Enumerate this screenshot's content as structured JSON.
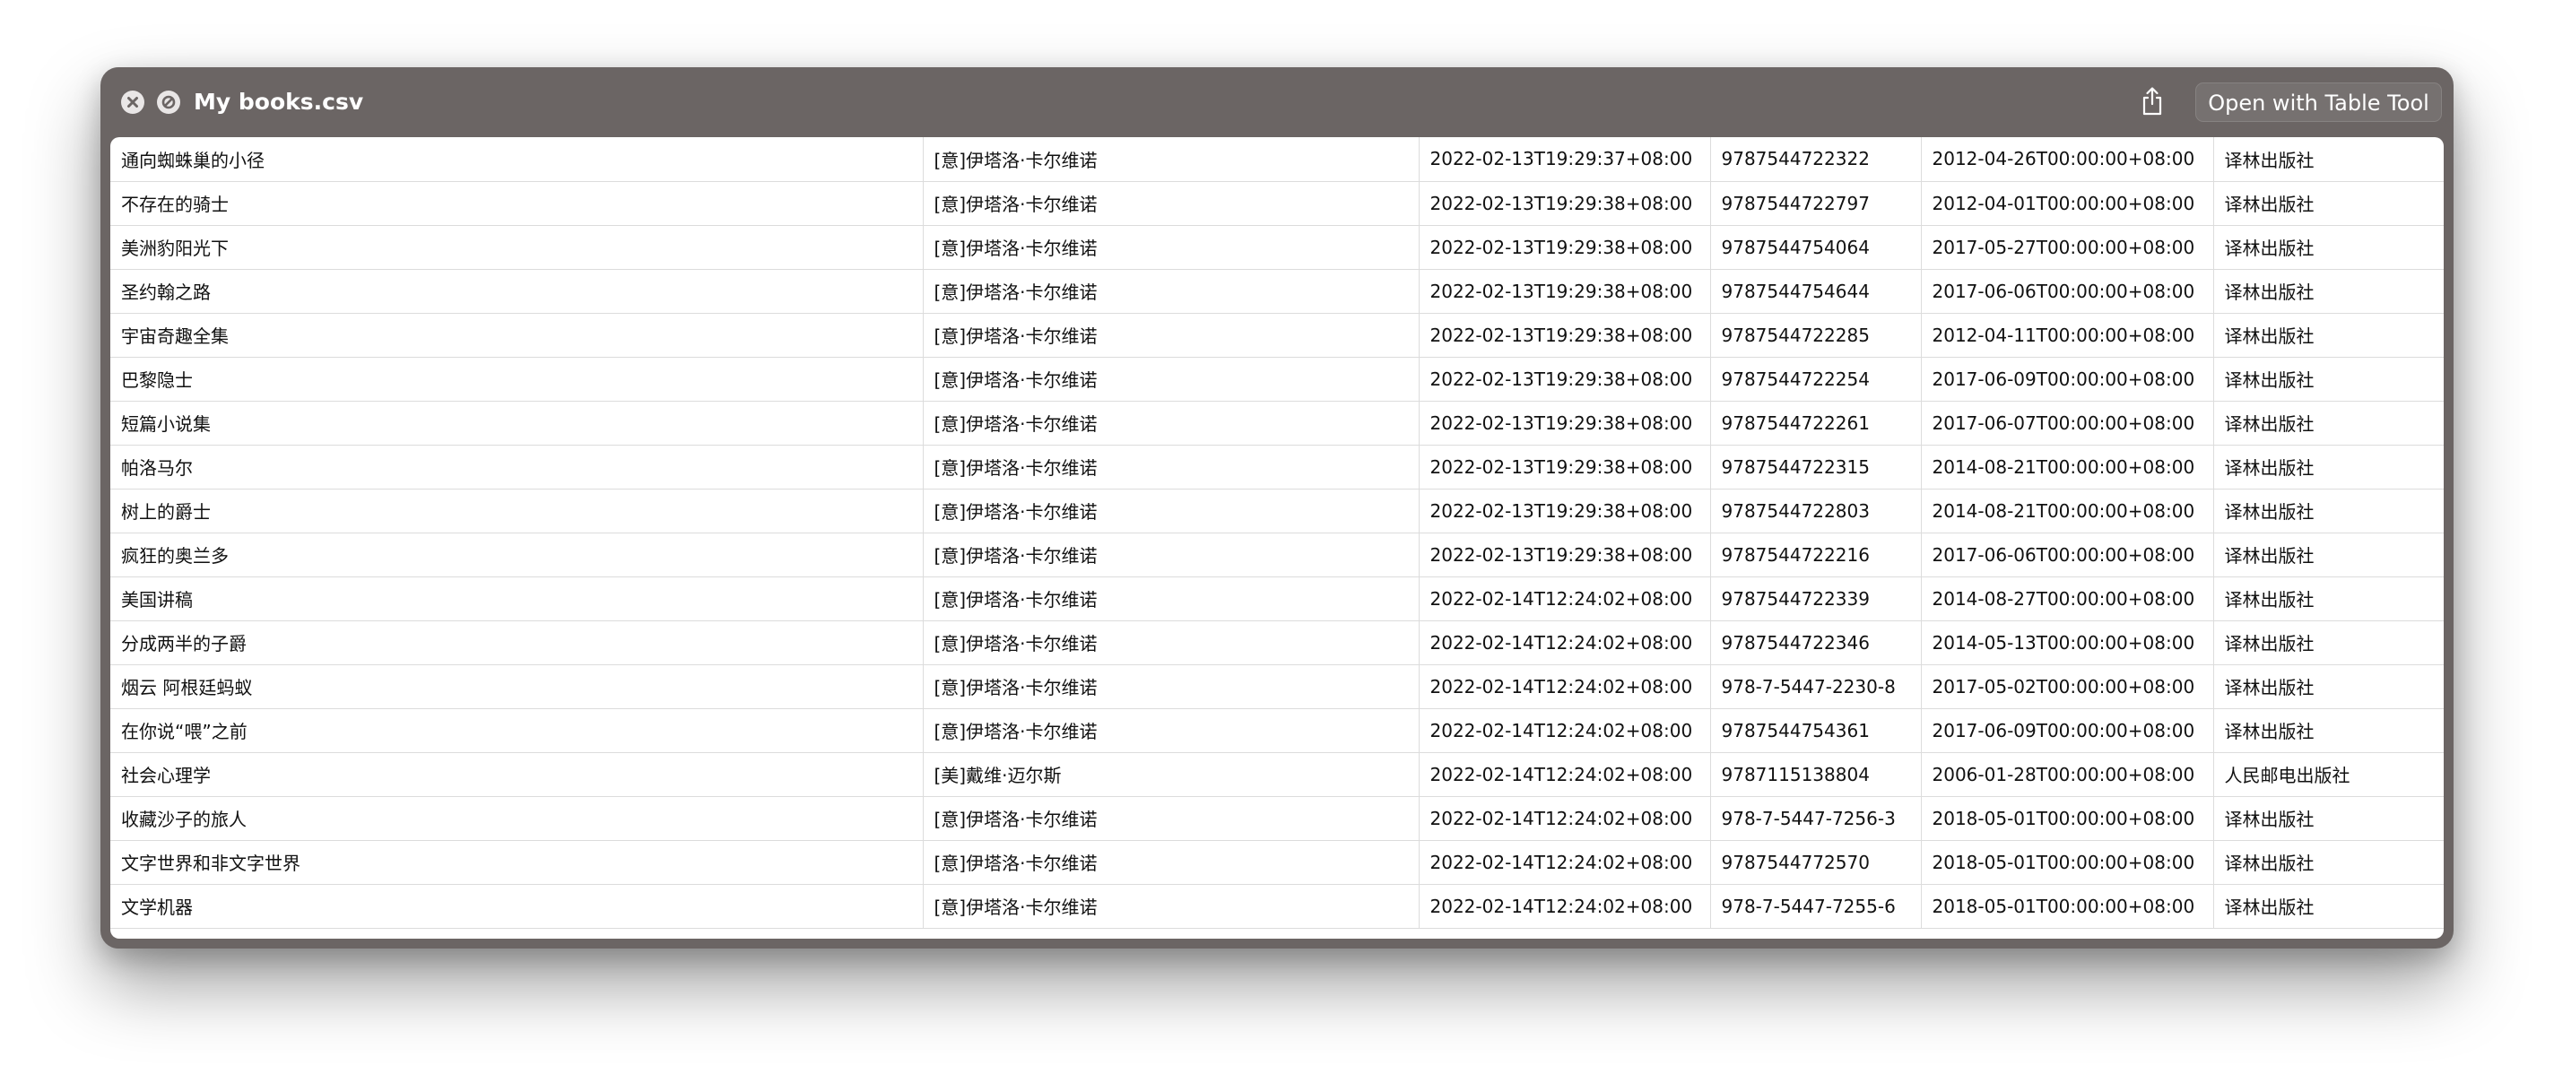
{
  "window": {
    "title": "My books.csv",
    "open_button_label": "Open with Table Tool"
  },
  "icons": {
    "close": "close-icon",
    "quicklook": "quicklook-icon",
    "share": "share-icon"
  },
  "colors": {
    "titlebar": "#6b6564",
    "grid": "#dcdcdc"
  },
  "table": {
    "rows": [
      [
        "通向蜘蛛巢的小径",
        "[意]伊塔洛·卡尔维诺",
        "2022-02-13T19:29:37+08:00",
        "9787544722322",
        "2012-04-26T00:00:00+08:00",
        "译林出版社"
      ],
      [
        "不存在的骑士",
        "[意]伊塔洛·卡尔维诺",
        "2022-02-13T19:29:38+08:00",
        "9787544722797",
        "2012-04-01T00:00:00+08:00",
        "译林出版社"
      ],
      [
        "美洲豹阳光下",
        "[意]伊塔洛·卡尔维诺",
        "2022-02-13T19:29:38+08:00",
        "9787544754064",
        "2017-05-27T00:00:00+08:00",
        "译林出版社"
      ],
      [
        "圣约翰之路",
        "[意]伊塔洛·卡尔维诺",
        "2022-02-13T19:29:38+08:00",
        "9787544754644",
        "2017-06-06T00:00:00+08:00",
        "译林出版社"
      ],
      [
        "宇宙奇趣全集",
        "[意]伊塔洛·卡尔维诺",
        "2022-02-13T19:29:38+08:00",
        "9787544722285",
        "2012-04-11T00:00:00+08:00",
        "译林出版社"
      ],
      [
        "巴黎隐士",
        "[意]伊塔洛·卡尔维诺",
        "2022-02-13T19:29:38+08:00",
        "9787544722254",
        "2017-06-09T00:00:00+08:00",
        "译林出版社"
      ],
      [
        "短篇小说集",
        "[意]伊塔洛·卡尔维诺",
        "2022-02-13T19:29:38+08:00",
        "9787544722261",
        "2017-06-07T00:00:00+08:00",
        "译林出版社"
      ],
      [
        "帕洛马尔",
        "[意]伊塔洛·卡尔维诺",
        "2022-02-13T19:29:38+08:00",
        "9787544722315",
        "2014-08-21T00:00:00+08:00",
        "译林出版社"
      ],
      [
        "树上的爵士",
        "[意]伊塔洛·卡尔维诺",
        "2022-02-13T19:29:38+08:00",
        "9787544722803",
        "2014-08-21T00:00:00+08:00",
        "译林出版社"
      ],
      [
        "疯狂的奥兰多",
        "[意]伊塔洛·卡尔维诺",
        "2022-02-13T19:29:38+08:00",
        "9787544722216",
        "2017-06-06T00:00:00+08:00",
        "译林出版社"
      ],
      [
        "美国讲稿",
        "[意]伊塔洛·卡尔维诺",
        "2022-02-14T12:24:02+08:00",
        "9787544722339",
        "2014-08-27T00:00:00+08:00",
        "译林出版社"
      ],
      [
        "分成两半的子爵",
        "[意]伊塔洛·卡尔维诺",
        "2022-02-14T12:24:02+08:00",
        "9787544722346",
        "2014-05-13T00:00:00+08:00",
        "译林出版社"
      ],
      [
        "烟云 阿根廷蚂蚁",
        "[意]伊塔洛·卡尔维诺",
        "2022-02-14T12:24:02+08:00",
        "978-7-5447-2230-8",
        "2017-05-02T00:00:00+08:00",
        "译林出版社"
      ],
      [
        "在你说“喂”之前",
        "[意]伊塔洛·卡尔维诺",
        "2022-02-14T12:24:02+08:00",
        "9787544754361",
        "2017-06-09T00:00:00+08:00",
        "译林出版社"
      ],
      [
        "社会心理学",
        "[美]戴维·迈尔斯",
        "2022-02-14T12:24:02+08:00",
        "9787115138804",
        "2006-01-28T00:00:00+08:00",
        "人民邮电出版社"
      ],
      [
        "收藏沙子的旅人",
        "[意]伊塔洛·卡尔维诺",
        "2022-02-14T12:24:02+08:00",
        "978-7-5447-7256-3",
        "2018-05-01T00:00:00+08:00",
        "译林出版社"
      ],
      [
        "文字世界和非文字世界",
        "[意]伊塔洛·卡尔维诺",
        "2022-02-14T12:24:02+08:00",
        "9787544772570",
        "2018-05-01T00:00:00+08:00",
        "译林出版社"
      ],
      [
        "文学机器",
        "[意]伊塔洛·卡尔维诺",
        "2022-02-14T12:24:02+08:00",
        "978-7-5447-7255-6",
        "2018-05-01T00:00:00+08:00",
        "译林出版社"
      ]
    ]
  }
}
